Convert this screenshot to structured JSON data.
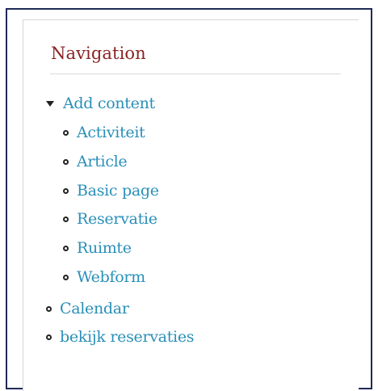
{
  "navigation": {
    "title": "Navigation",
    "add_content": {
      "label": "Add content",
      "children": [
        "Activiteit",
        "Article",
        "Basic page",
        "Reservatie",
        "Ruimte",
        "Webform"
      ]
    },
    "calendar": "Calendar",
    "bekijk_reservaties": "bekijk reservaties"
  },
  "colors": {
    "title": "#8b2323",
    "link": "#2a8fb8",
    "frame_border": "#1f2a57"
  }
}
